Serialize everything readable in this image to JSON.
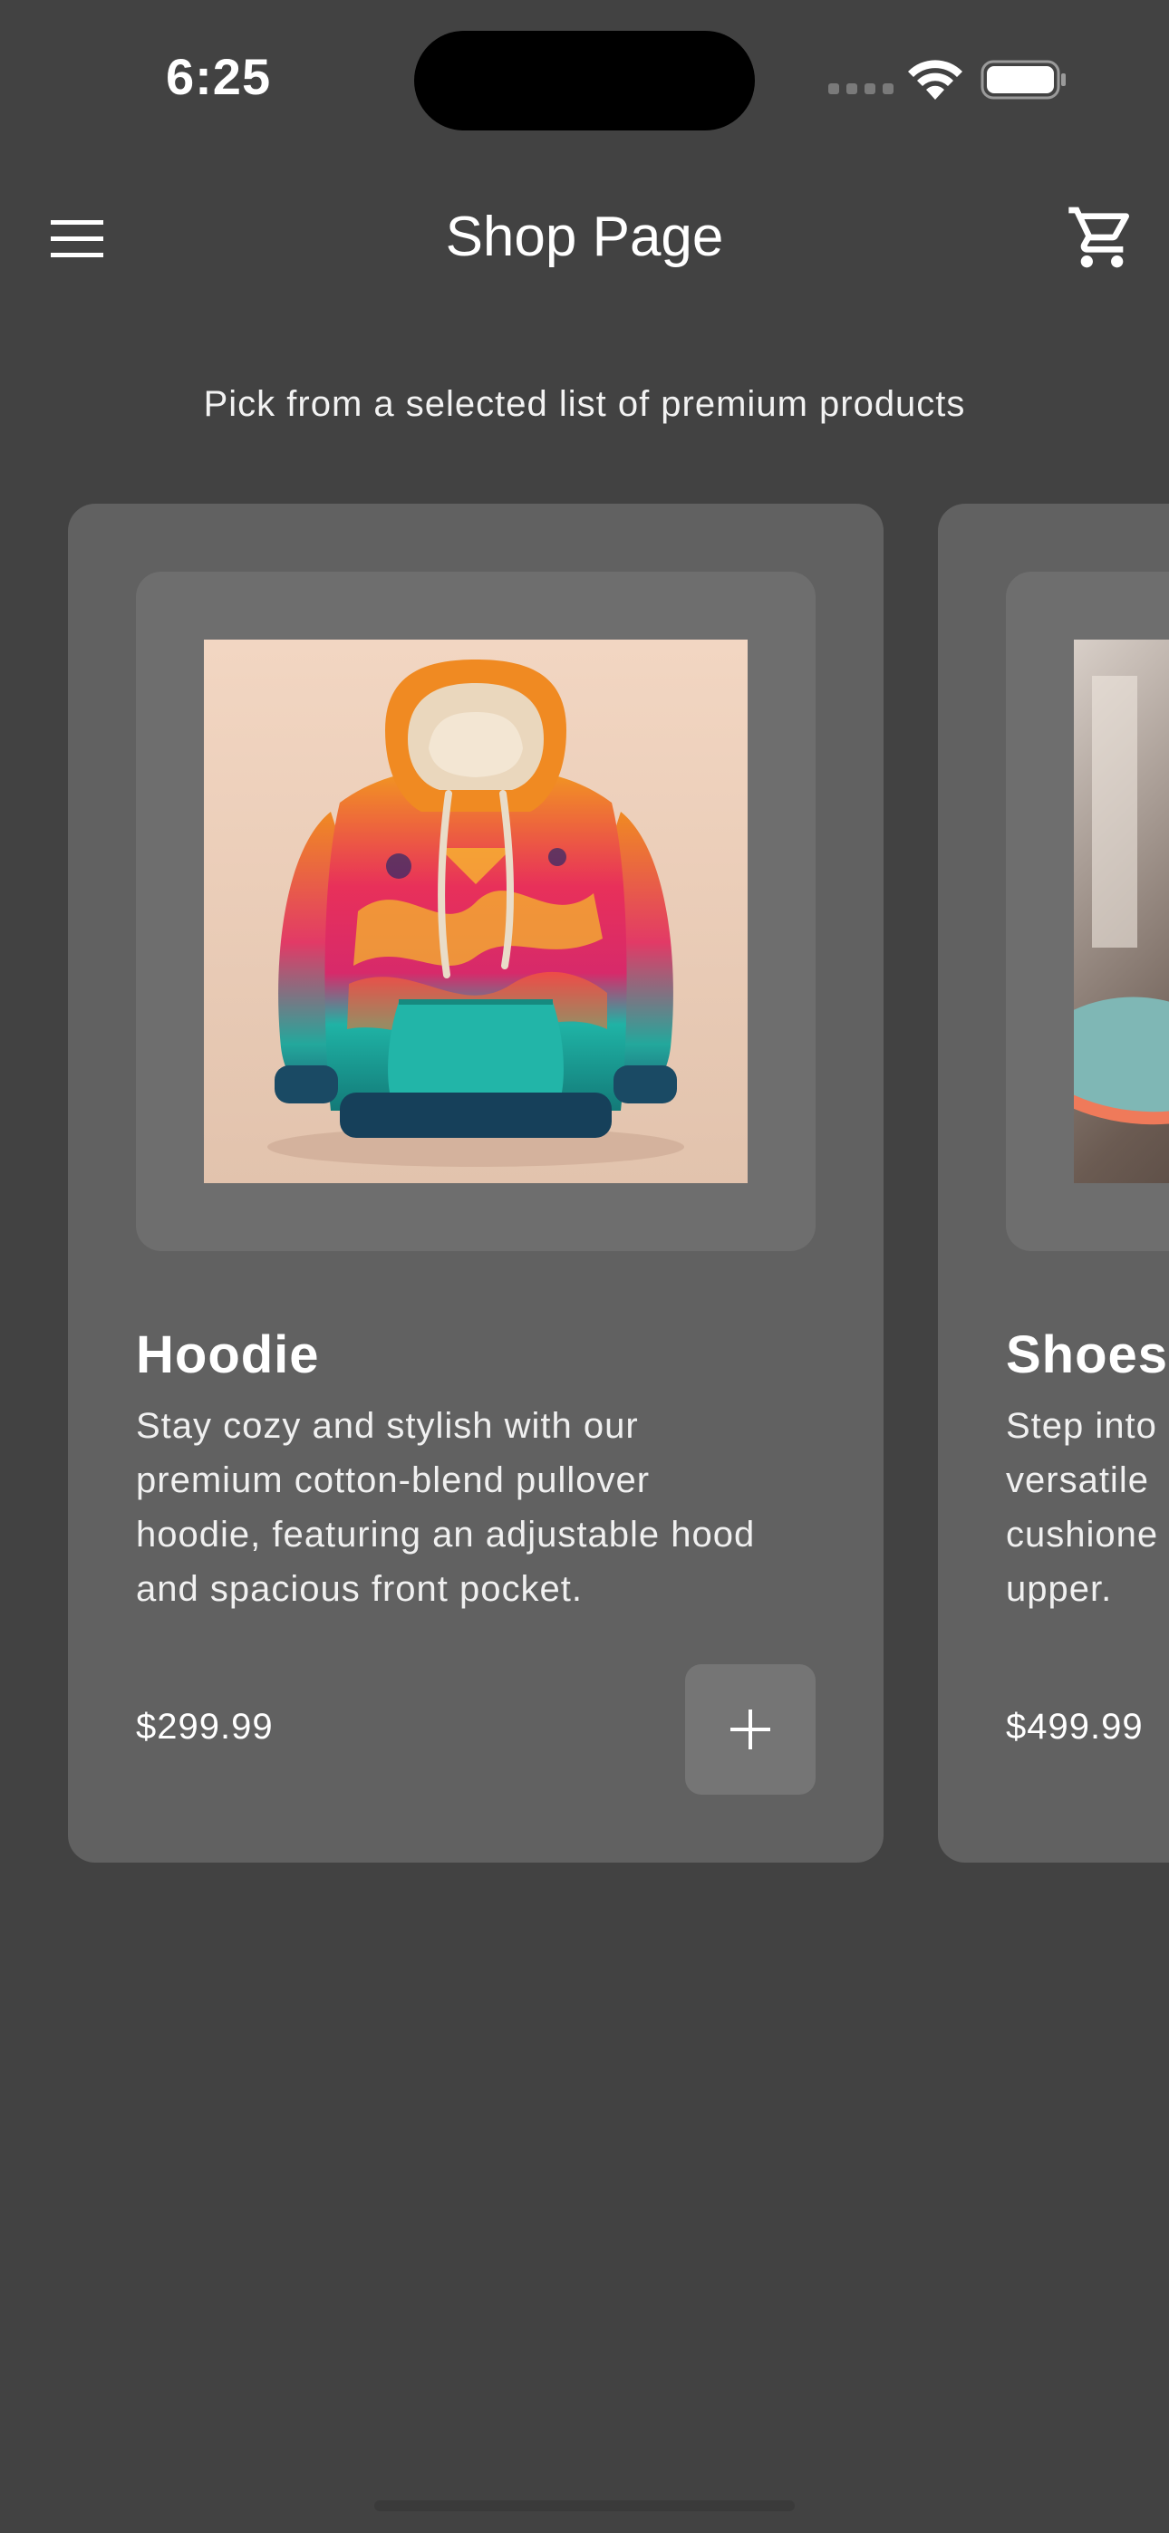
{
  "status_bar": {
    "time": "6:25"
  },
  "app_bar": {
    "title": "Shop Page",
    "menu_icon": "hamburger-menu-icon",
    "cart_icon": "shopping-cart-icon"
  },
  "subtitle": "Pick from a selected list of premium products",
  "products": [
    {
      "name": "Hoodie",
      "description": "Stay cozy and stylish with our premium cotton-blend pullover hoodie, featuring an adjustable hood and spacious front pocket.",
      "price": "$299.99",
      "image_icon": "hoodie-image"
    },
    {
      "name": "Shoes",
      "description": "Step into versatile cushioned upper.",
      "price": "$499.99",
      "image_icon": "shoe-image"
    }
  ],
  "colors": {
    "background": "#424242",
    "card": "#616161",
    "image_frame": "#6e6e6e",
    "add_button": "#757575",
    "text": "#ffffff"
  }
}
